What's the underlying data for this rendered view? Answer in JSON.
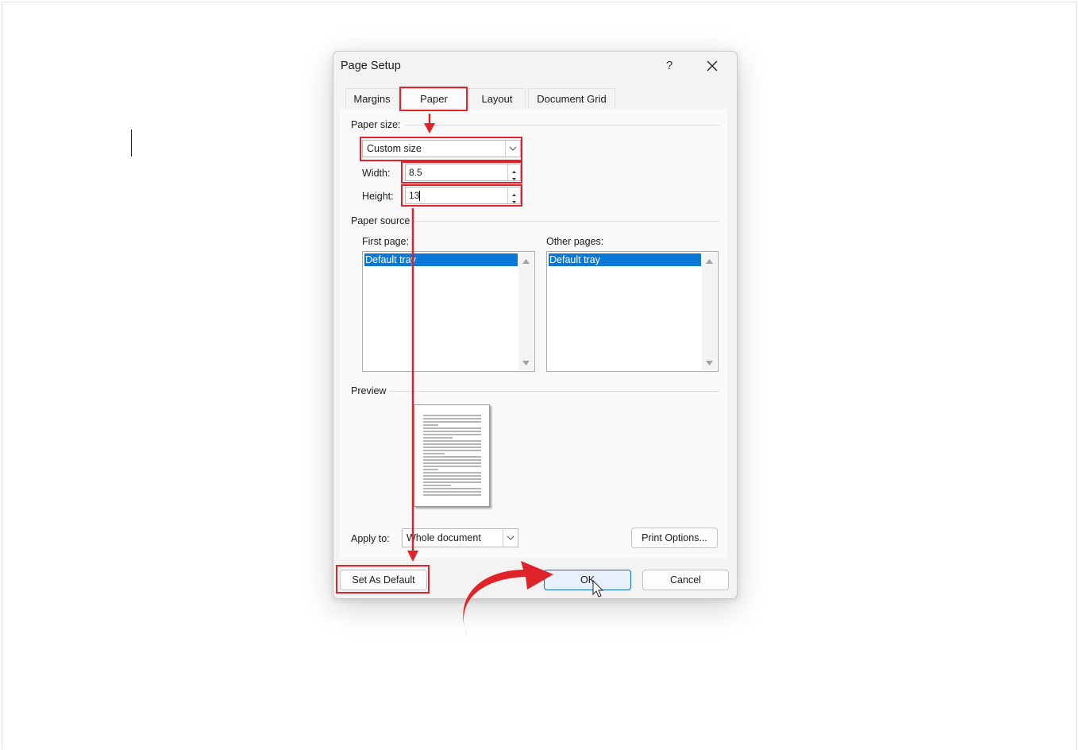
{
  "dialog": {
    "title": "Page Setup",
    "help": "?"
  },
  "tabs": [
    {
      "label": "Margins"
    },
    {
      "label": "Paper"
    },
    {
      "label": "Layout"
    },
    {
      "label": "Document Grid"
    }
  ],
  "paper": {
    "paper_size_label": "Paper size:",
    "paper_size_value": "Custom size",
    "width_label": "Width:",
    "width_value": "8.5",
    "height_label": "Height:",
    "height_value": "13"
  },
  "paper_source": {
    "label": "Paper source",
    "first_page_label": "First page:",
    "first_page_selected": "Default tray",
    "other_pages_label": "Other pages:",
    "other_pages_selected": "Default tray"
  },
  "preview": {
    "label": "Preview"
  },
  "apply": {
    "label": "Apply to:",
    "value": "Whole document",
    "print_options": "Print Options..."
  },
  "footer": {
    "set_as_default": "Set As Default",
    "ok": "OK",
    "cancel": "Cancel"
  },
  "colors": {
    "annotation": "#e0222a",
    "selection": "#0a78d7"
  }
}
